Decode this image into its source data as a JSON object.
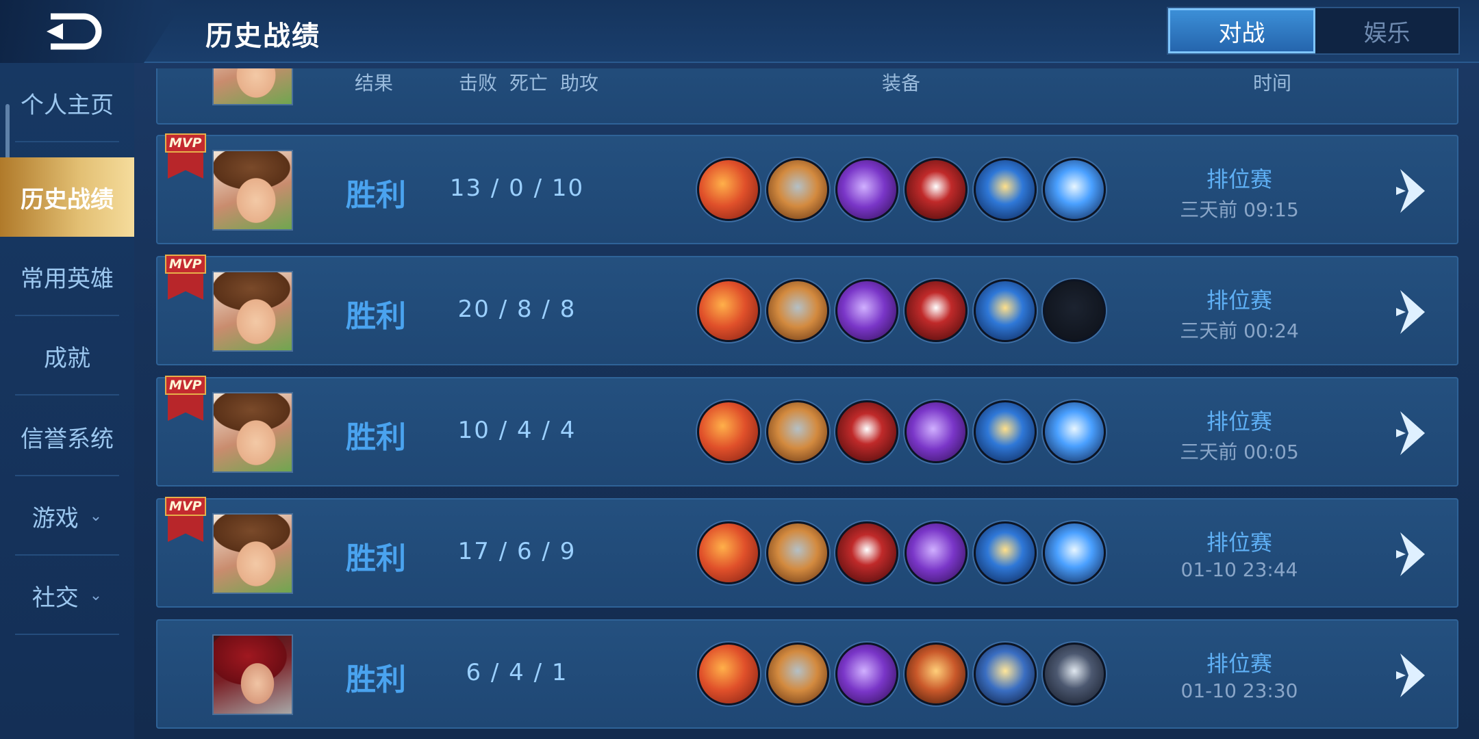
{
  "header": {
    "title": "历史战绩",
    "tabs": [
      {
        "label": "对战",
        "active": true
      },
      {
        "label": "娱乐",
        "active": false
      }
    ]
  },
  "sidebar": {
    "items": [
      {
        "label": "个人主页",
        "active": false,
        "expandable": false
      },
      {
        "label": "历史战绩",
        "active": true,
        "expandable": false
      },
      {
        "label": "常用英雄",
        "active": false,
        "expandable": false
      },
      {
        "label": "成就",
        "active": false,
        "expandable": false
      },
      {
        "label": "信誉系统",
        "active": false,
        "expandable": false
      },
      {
        "label": "游戏",
        "active": false,
        "expandable": true
      },
      {
        "label": "社交",
        "active": false,
        "expandable": true
      }
    ]
  },
  "columns": {
    "result": "结果",
    "kills": "击败",
    "deaths": "死亡",
    "assists": "助攻",
    "equipment": "装备",
    "time": "时间"
  },
  "matches": [
    {
      "mvp": true,
      "mvp_text": "MVP",
      "hero": "hero-a",
      "result": "胜利",
      "kda": "13 / 0 / 10",
      "items": [
        "sword-orange-icon",
        "boots-icon",
        "axe-purple-icon",
        "blade-red-icon",
        "trident-blue-icon",
        "spear-blue-icon"
      ],
      "mode": "排位赛",
      "time": "三天前 09:15"
    },
    {
      "mvp": true,
      "mvp_text": "MVP",
      "hero": "hero-a",
      "result": "胜利",
      "kda": "20 / 8 / 8",
      "items": [
        "sword-orange-icon",
        "boots-icon",
        "axe-purple-icon",
        "blade-red-icon",
        "trident-blue-icon",
        "empty-slot-icon"
      ],
      "mode": "排位赛",
      "time": "三天前 00:24"
    },
    {
      "mvp": true,
      "mvp_text": "MVP",
      "hero": "hero-a",
      "result": "胜利",
      "kda": "10 / 4 / 4",
      "items": [
        "sword-orange-icon",
        "boots-icon",
        "blade-red-icon",
        "axe-purple-icon",
        "trident-blue-icon",
        "spear-blue-icon"
      ],
      "mode": "排位赛",
      "time": "三天前 00:05"
    },
    {
      "mvp": true,
      "mvp_text": "MVP",
      "hero": "hero-a",
      "result": "胜利",
      "kda": "17 / 6 / 9",
      "items": [
        "sword-orange-icon",
        "boots-icon",
        "blade-red-icon",
        "axe-purple-icon",
        "trident-blue-icon",
        "spear-blue-icon"
      ],
      "mode": "排位赛",
      "time": "01-10  23:44"
    },
    {
      "mvp": false,
      "mvp_text": "",
      "hero": "hero-b",
      "result": "胜利",
      "kda": "6 / 4 / 1",
      "items": [
        "sword-orange-icon",
        "boots-icon",
        "axe-purple-icon",
        "dagger-gold-icon",
        "sun-gold-icon",
        "sword-dark-icon"
      ],
      "mode": "排位赛",
      "time": "01-10  23:30"
    }
  ]
}
